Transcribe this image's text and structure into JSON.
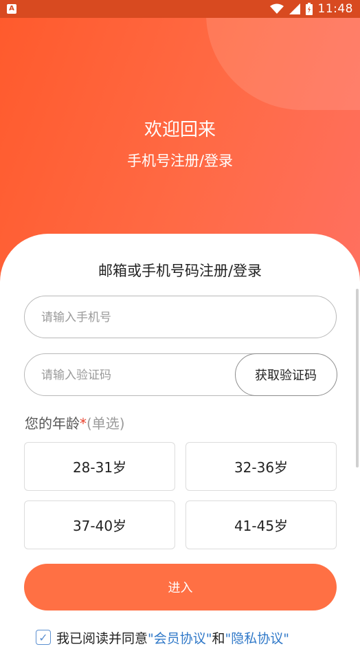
{
  "status_bar": {
    "time": "11:48",
    "app_badge": "A"
  },
  "hero": {
    "title": "欢迎回来",
    "subtitle": "手机号注册/登录"
  },
  "form": {
    "title": "邮箱或手机号码注册/登录",
    "phone_placeholder": "请输入手机号",
    "code_placeholder": "请输入验证码",
    "get_code_label": "获取验证码"
  },
  "age": {
    "label": "您的年龄",
    "required_mark": "*",
    "hint": "(单选)",
    "options": [
      "28-31岁",
      "32-36岁",
      "37-40岁",
      "41-45岁"
    ]
  },
  "enter_label": "进入",
  "agreement": {
    "check_mark": "✓",
    "prefix": "我已阅读并同意",
    "link1": "\"会员协议\"",
    "middle": "和",
    "link2": "\"隐私协议\""
  },
  "colors": {
    "accent": "#ff6a3d",
    "link": "#2f78c8"
  }
}
